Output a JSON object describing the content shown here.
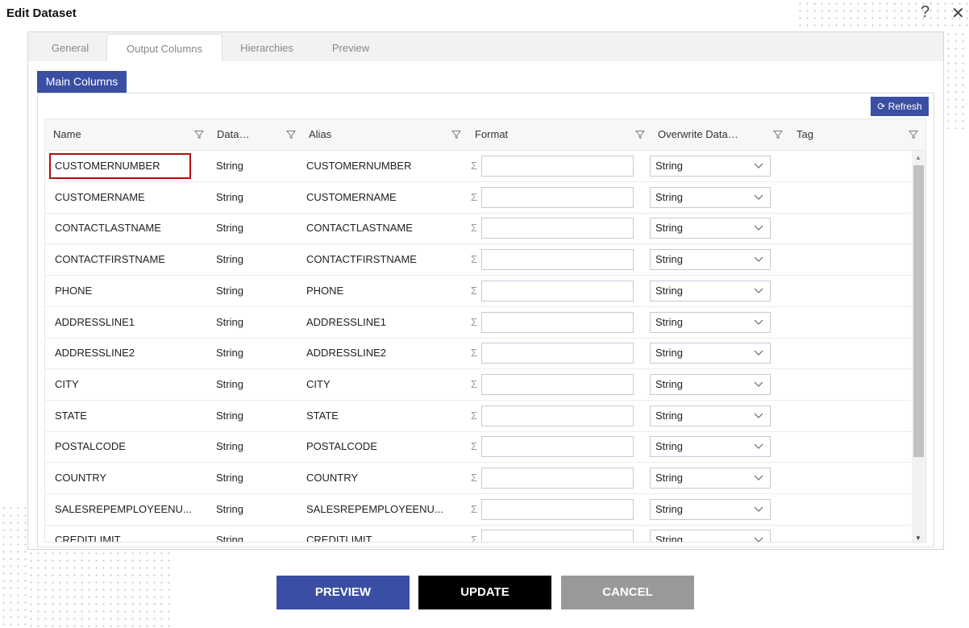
{
  "dialog": {
    "title": "Edit Dataset",
    "help_icon": "question-icon",
    "close_icon": "close-icon"
  },
  "tabs": [
    {
      "label": "General"
    },
    {
      "label": "Output Columns",
      "active": true
    },
    {
      "label": "Hierarchies"
    },
    {
      "label": "Preview"
    }
  ],
  "subtab": "Main Columns",
  "refresh_label": "Refresh",
  "columns": [
    "Name",
    "Data…",
    "Alias",
    "Format",
    "Overwrite Data…",
    "Tag"
  ],
  "rows": [
    {
      "name": "CUSTOMERNUMBER",
      "type": "String",
      "alias": "CUSTOMERNUMBER",
      "format": "",
      "overwrite": "String",
      "tag": "",
      "selected": true
    },
    {
      "name": "CUSTOMERNAME",
      "type": "String",
      "alias": "CUSTOMERNAME",
      "format": "",
      "overwrite": "String",
      "tag": ""
    },
    {
      "name": "CONTACTLASTNAME",
      "type": "String",
      "alias": "CONTACTLASTNAME",
      "format": "",
      "overwrite": "String",
      "tag": ""
    },
    {
      "name": "CONTACTFIRSTNAME",
      "type": "String",
      "alias": "CONTACTFIRSTNAME",
      "format": "",
      "overwrite": "String",
      "tag": ""
    },
    {
      "name": "PHONE",
      "type": "String",
      "alias": "PHONE",
      "format": "",
      "overwrite": "String",
      "tag": ""
    },
    {
      "name": "ADDRESSLINE1",
      "type": "String",
      "alias": "ADDRESSLINE1",
      "format": "",
      "overwrite": "String",
      "tag": ""
    },
    {
      "name": "ADDRESSLINE2",
      "type": "String",
      "alias": "ADDRESSLINE2",
      "format": "",
      "overwrite": "String",
      "tag": ""
    },
    {
      "name": "CITY",
      "type": "String",
      "alias": "CITY",
      "format": "",
      "overwrite": "String",
      "tag": ""
    },
    {
      "name": "STATE",
      "type": "String",
      "alias": "STATE",
      "format": "",
      "overwrite": "String",
      "tag": ""
    },
    {
      "name": "POSTALCODE",
      "type": "String",
      "alias": "POSTALCODE",
      "format": "",
      "overwrite": "String",
      "tag": ""
    },
    {
      "name": "COUNTRY",
      "type": "String",
      "alias": "COUNTRY",
      "format": "",
      "overwrite": "String",
      "tag": ""
    },
    {
      "name": "SALESREPEMPLOYEENU...",
      "type": "String",
      "alias": "SALESREPEMPLOYEENU...",
      "format": "",
      "overwrite": "String",
      "tag": ""
    },
    {
      "name": "CREDITLIMIT",
      "type": "String",
      "alias": "CREDITLIMIT",
      "format": "",
      "overwrite": "String",
      "tag": ""
    }
  ],
  "buttons": {
    "preview": "PREVIEW",
    "update": "UPDATE",
    "cancel": "CANCEL"
  },
  "colors": {
    "accent": "#3a4fa3",
    "update": "#000000",
    "cancel": "#999999",
    "selection": "#b20f0f"
  }
}
